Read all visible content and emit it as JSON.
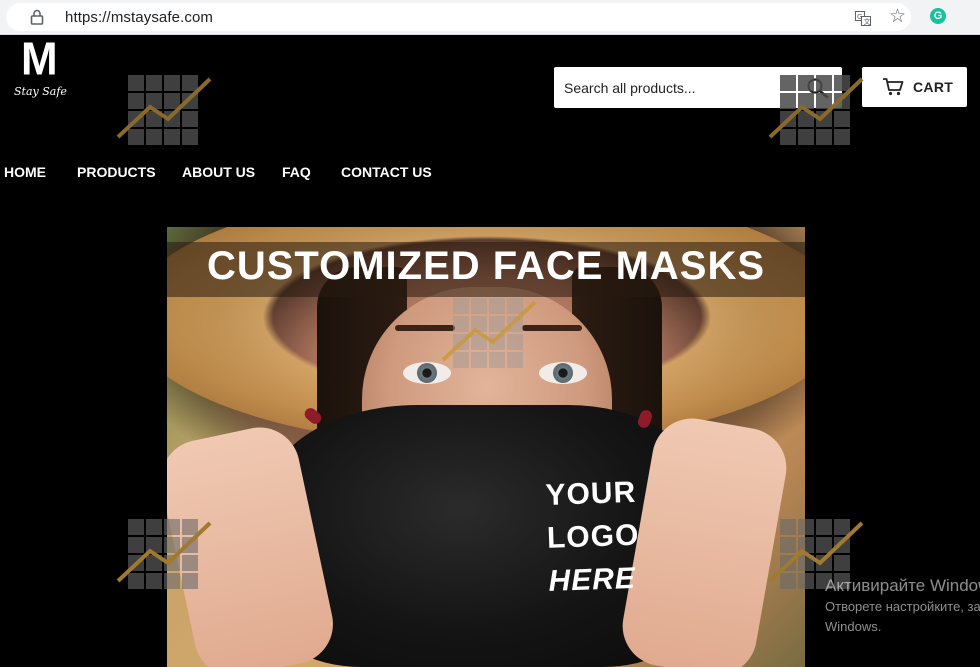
{
  "browser": {
    "url": "https://mstaysafe.com",
    "icons": [
      "lock-icon",
      "translate-icon",
      "star-icon",
      "grammarly-icon"
    ],
    "grammarly_glyph": "G"
  },
  "header": {
    "logo_mark": "M",
    "logo_tagline": "Stay Safe",
    "search": {
      "placeholder": "Search all products..."
    },
    "cart_label": "CART"
  },
  "nav": {
    "items": [
      "HOME",
      "PRODUCTS",
      "ABOUT US",
      "FAQ",
      "CONTACT US"
    ]
  },
  "hero": {
    "title": "CUSTOMIZED FACE MASKS",
    "mask_print": [
      "YOUR",
      "LOGO",
      "HERE"
    ]
  },
  "os_overlay": {
    "title": "Активирайте Windows",
    "line1": "Отворете настройките, за да",
    "line2": "Windows."
  },
  "colors": {
    "page_background": "#000000",
    "header_buttons": "#ffffff",
    "watermark_line": "#8a6a2a"
  }
}
